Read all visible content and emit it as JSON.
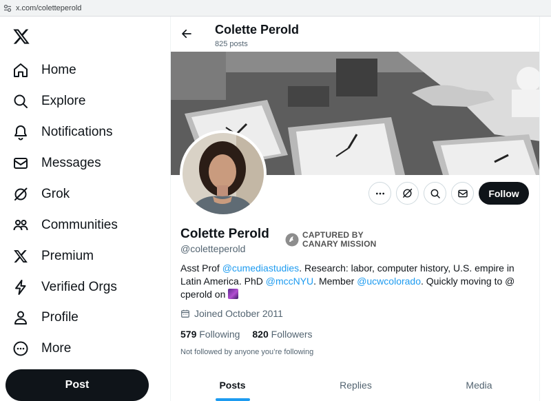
{
  "browser": {
    "url": "x.com/coletteperold"
  },
  "nav": {
    "items": [
      {
        "label": "Home",
        "icon": "home-icon"
      },
      {
        "label": "Explore",
        "icon": "search-icon"
      },
      {
        "label": "Notifications",
        "icon": "bell-icon"
      },
      {
        "label": "Messages",
        "icon": "envelope-icon"
      },
      {
        "label": "Grok",
        "icon": "grok-icon"
      },
      {
        "label": "Communities",
        "icon": "people-icon"
      },
      {
        "label": "Premium",
        "icon": "x-logo-icon"
      },
      {
        "label": "Verified Orgs",
        "icon": "lightning-icon"
      },
      {
        "label": "Profile",
        "icon": "person-icon"
      },
      {
        "label": "More",
        "icon": "more-circle-icon"
      }
    ],
    "post_label": "Post"
  },
  "header": {
    "name": "Colette Perold",
    "post_count": "825 posts"
  },
  "profile": {
    "name": "Colette Perold",
    "handle": "@coletteperold",
    "badge_line1": "CAPTURED BY",
    "badge_line2": "CANARY MISSION",
    "bio": {
      "t1": "Asst Prof ",
      "l1": "@cumediastudies",
      "t2": ". Research: labor, computer history, U.S. empire in Latin America. PhD ",
      "l2": "@mccNYU",
      "t3": ". Member ",
      "l3": "@ucwcolorado",
      "t4": ". Quickly moving to @ cperold on "
    },
    "joined": "Joined October 2011",
    "following_count": "579",
    "following_label": "Following",
    "followers_count": "820",
    "followers_label": "Followers",
    "not_followed": "Not followed by anyone you’re following"
  },
  "actions": {
    "follow_label": "Follow"
  },
  "tabs": [
    {
      "label": "Posts"
    },
    {
      "label": "Replies"
    },
    {
      "label": "Media"
    }
  ],
  "colors": {
    "accent": "#1d9bf0",
    "text": "#0f1419",
    "muted": "#536471",
    "button_dark": "#0f1419"
  }
}
